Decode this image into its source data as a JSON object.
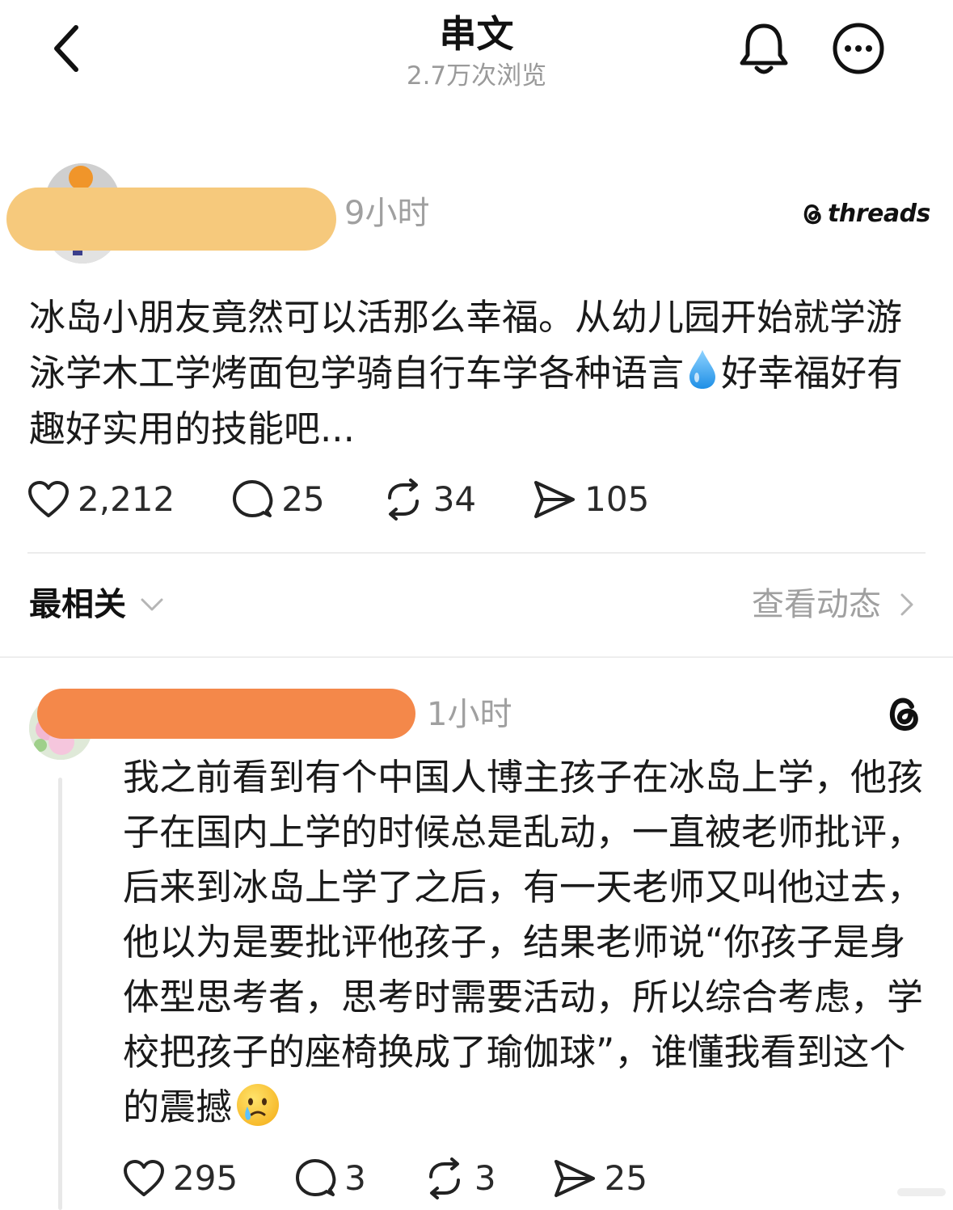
{
  "header": {
    "title": "串文",
    "views": "2.7万次浏览",
    "back_icon": "chevron-left-icon",
    "bell_icon": "bell-icon",
    "more_icon": "more-horizontal-icon"
  },
  "post": {
    "time": "9小时",
    "brand": "threads",
    "text_before_emoji": "冰岛小朋友竟然可以活那么幸福。从幼儿园开始就学游泳学木工学烤面包学骑自行车学各种语言",
    "emoji": "droplet-emoji",
    "text_after_emoji": "好幸福好有趣好实用的技能吧...",
    "likes": "2,212",
    "comments": "25",
    "reposts": "34",
    "shares": "105"
  },
  "controls": {
    "sort_label": "最相关",
    "activity_label": "查看动态"
  },
  "reply": {
    "time": "1小时",
    "text": "我之前看到有个中国人博主孩子在冰岛上学，他孩子在国内上学的时候总是乱动，一直被老师批评，后来到冰岛上学了之后，有一天老师又叫他过去，他以为是要批评他孩子，结果老师说“你孩子是身体型思考者，思考时需要活动，所以综合考虑，学校把孩子的座椅换成了瑜伽球”，谁懂我看到这个的震撼",
    "emoji": "crying-face-emoji",
    "likes": "295",
    "comments": "3",
    "reposts": "3",
    "shares": "25"
  },
  "colors": {
    "redaction_main": "#f6c97c",
    "redaction_reply": "#f4884a",
    "muted_text": "#a0a0a0"
  }
}
